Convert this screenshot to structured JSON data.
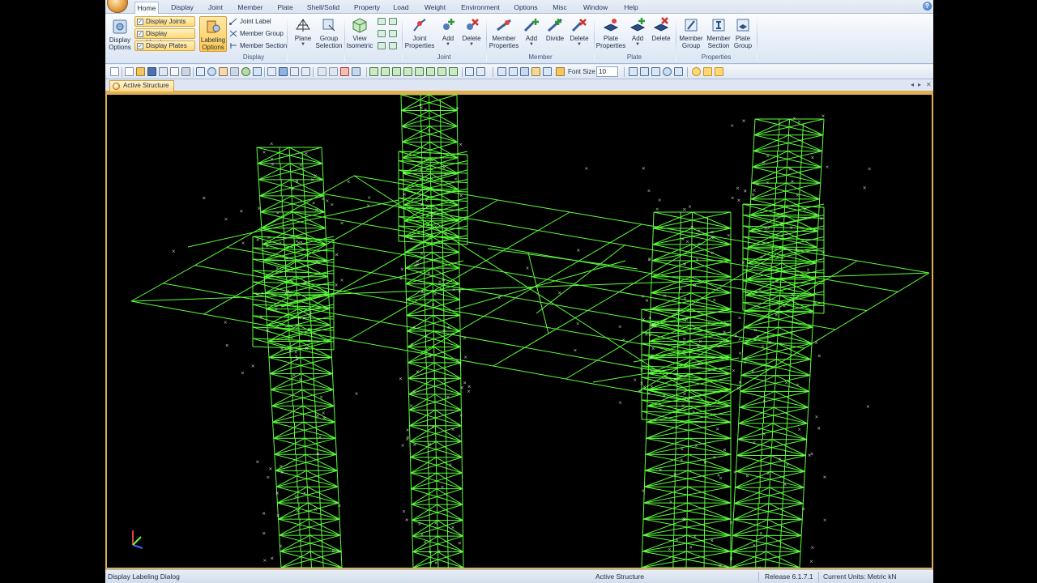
{
  "tabs": [
    "Home",
    "Display",
    "Joint",
    "Member",
    "Plate",
    "Shell/Solid",
    "Property",
    "Load",
    "Weight",
    "Environment",
    "Options",
    "Misc",
    "Window",
    "Help"
  ],
  "ribbon": {
    "display_options": [
      "Display",
      "Options"
    ],
    "toggles": [
      "Display Joints",
      "Display Members",
      "Display Plates"
    ],
    "labeling_options": [
      "Labeling",
      "Options"
    ],
    "label_items": [
      "Joint Label",
      "Member Group",
      "Member Section"
    ],
    "plane": "Plane",
    "group_selection": [
      "Group",
      "Selection"
    ],
    "view_isometric": [
      "View",
      "Isometric"
    ],
    "joint_properties": [
      "Joint",
      "Properties"
    ],
    "joint_add": "Add",
    "joint_delete": "Delete",
    "member_properties": [
      "Member",
      "Properties"
    ],
    "member_add": "Add",
    "member_divide": "Divide",
    "member_delete": "Delete",
    "plate_properties": [
      "Plate",
      "Properties"
    ],
    "plate_add": "Add",
    "plate_delete": "Delete",
    "member_group": [
      "Member",
      "Group"
    ],
    "member_section": [
      "Member",
      "Section"
    ],
    "plate_group": [
      "Plate",
      "Group"
    ],
    "groups": [
      "Display",
      "Joint",
      "Member",
      "Plate",
      "Properties"
    ]
  },
  "toolbar": {
    "font_size_label": "Font Size",
    "font_size_value": "10"
  },
  "document": {
    "tab": "Active Structure"
  },
  "status": {
    "message": "Display Labeling Dialog",
    "structure": "Active Structure",
    "release": "Release 6.1.7.1",
    "units": "Current Units: Metric kN"
  },
  "colors": {
    "wireframe": "#5cff3c",
    "viewport_bg": "#000000",
    "highlight": "#ffd872"
  }
}
